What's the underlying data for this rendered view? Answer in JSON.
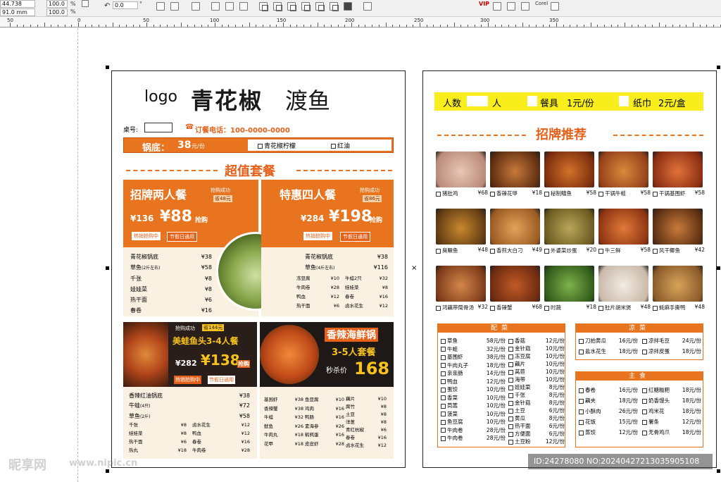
{
  "toolbar": {
    "size_w": "44.738 mm",
    "size_h": "91.0 mm",
    "scale_x": "100.0",
    "scale_y": "100.0",
    "pct": "%",
    "rotation": "0.0",
    "deg": "°",
    "vip_label": "VIP",
    "corel_label": "Corel"
  },
  "ruler": {
    "labels": [
      "50",
      "0",
      "50",
      "100",
      "150",
      "200",
      "250",
      "300",
      "350"
    ]
  },
  "left_page": {
    "logo": "logo",
    "brand": "青花椒",
    "brand2": "渡鱼",
    "table_no_label": "桌号:",
    "phone": "订餐电话：100-0000-0000",
    "pot_label": "锅底：",
    "pot_price": "38",
    "pot_unit": "元/份",
    "pot_opt1": "青花椒柠檬",
    "pot_opt2": "红油",
    "section_title": "超值套餐",
    "set1": {
      "title": "招牌两人餐",
      "tag1": "抢购成功",
      "tag2": "省48元",
      "old": "¥136",
      "price": "¥88",
      "buy": "抢购",
      "hot": "热销抢购中",
      "hol": "节假日通用",
      "items": [
        [
          "青花椒锅底",
          "¥38"
        ],
        [
          "草鱼",
          "(2斤左右)",
          "¥58"
        ],
        [
          "千张",
          "¥8"
        ],
        [
          "娃娃菜",
          "¥8"
        ],
        [
          "热干面",
          "¥6"
        ],
        [
          "春卷",
          "¥16"
        ]
      ]
    },
    "set2": {
      "title": "特惠四人餐",
      "tag1": "抢购成功",
      "tag2": "省86元",
      "old": "¥284",
      "price": "¥198",
      "buy": "抢购",
      "hot": "热销抢购中",
      "hol": "节假日通用",
      "items": [
        [
          "青花椒锅底",
          "¥38"
        ],
        [
          "草鱼",
          "(4斤左右)",
          "¥116"
        ]
      ],
      "small": [
        [
          "冻豆腐",
          "¥10"
        ],
        [
          "牛蛙2只",
          "¥32"
        ],
        [
          "牛肉卷",
          "¥28"
        ],
        [
          "娃娃菜",
          "¥8"
        ],
        [
          "鸭血",
          "¥12"
        ],
        [
          "春卷",
          "¥16"
        ],
        [
          "热干面",
          "¥6"
        ],
        [
          "卤水花生",
          "¥12"
        ]
      ]
    },
    "set3": {
      "tag1": "抢购成功",
      "tag2": "省144元",
      "title": "美蛙鱼头3-4人餐",
      "old": "¥282",
      "price": "¥138",
      "buy": "抢购",
      "hot": "热销抢购中",
      "hol": "节假日通用",
      "items": [
        [
          "香辣红油锅底",
          "¥38"
        ],
        [
          "牛蛙",
          "(4只)",
          "¥72"
        ],
        [
          "草鱼",
          "(2斤)",
          "¥58"
        ]
      ],
      "small": [
        [
          "千张",
          "¥8"
        ],
        [
          "卤水花生",
          "¥12"
        ],
        [
          "娃娃菜",
          "¥8"
        ],
        [
          "鸭血",
          "¥12"
        ],
        [
          "热干面",
          "¥6"
        ],
        [
          "春卷",
          "¥16"
        ],
        [
          "热丸",
          "¥18"
        ],
        [
          "牛肉卷",
          "¥28"
        ]
      ]
    },
    "set4": {
      "title": "香辣海鲜锅",
      "sub": "3-5人套餐",
      "promo": "秒杀价",
      "price": "168",
      "col1": [
        [
          "基围虾",
          "¥38"
        ],
        [
          "香辣蟹",
          "¥38"
        ],
        [
          "牛蛙",
          "¥32"
        ],
        [
          "鱿鱼",
          "¥26"
        ],
        [
          "牛肉丸",
          "¥18"
        ],
        [
          "花甲",
          "¥18"
        ]
      ],
      "col2": [
        [
          "鱼豆腐",
          "¥10"
        ],
        [
          "鸡肉",
          "¥16"
        ],
        [
          "鸭肠",
          "¥16"
        ],
        [
          "素海参",
          "¥26"
        ],
        [
          "鹌鹑蛋",
          "¥16"
        ],
        [
          "皮皮虾",
          "¥28"
        ]
      ],
      "col3": [
        [
          "藕片",
          "¥10"
        ],
        [
          "腐竹",
          "¥8"
        ],
        [
          "土豆",
          "¥8"
        ],
        [
          "洋葱",
          "¥8"
        ],
        [
          "青红杭椒",
          "¥6"
        ],
        [
          "春卷",
          "¥16"
        ],
        [
          "卤水花生",
          "¥12"
        ]
      ]
    }
  },
  "right_page": {
    "people": "人数",
    "people_unit": "人",
    "tableware": "餐具",
    "tableware_price": "1元/份",
    "tissue": "纸巾",
    "tissue_price": "2元/盒",
    "signature_title": "招牌推荐",
    "dishes": [
      [
        "猪肚鸡",
        "¥68"
      ],
      [
        "香辣花甲",
        "¥18"
      ],
      [
        "秘制鳝鱼",
        "¥58"
      ],
      [
        "干锅牛蛙",
        "¥58"
      ],
      [
        "干锅基围虾",
        "¥58"
      ],
      [
        "臭鳜鱼",
        "¥48"
      ],
      [
        "香煎大白刁",
        "¥49"
      ],
      [
        "外婆菜炒蛋",
        "¥20"
      ],
      [
        "牛三鲜",
        "¥58"
      ],
      [
        "风干鲫鱼",
        "¥42"
      ],
      [
        "鸿藕带筒骨汤",
        "¥32"
      ],
      [
        "香辣蟹",
        "¥68"
      ],
      [
        "时蔬",
        "¥18"
      ],
      [
        "肚片胡米煲",
        "¥48"
      ],
      [
        "蚝麻手撕鸭",
        "¥48"
      ]
    ],
    "sides_title": "配菜",
    "sides_col1": [
      [
        "草鱼",
        "58元/份"
      ],
      [
        "牛蛙",
        "32元/份"
      ],
      [
        "基围虾",
        "38元/份"
      ],
      [
        "牛肉丸子",
        "18元/份"
      ],
      [
        "亲亲肠",
        "14元/份"
      ],
      [
        "鸭血",
        "12元/份"
      ],
      [
        "蛋饺",
        "10元/份"
      ],
      [
        "香菜",
        "10元/份"
      ],
      [
        "茼蒿",
        "10元/份"
      ],
      [
        "菠菜",
        "10元/份"
      ],
      [
        "鱼豆腐",
        "10元/份"
      ],
      [
        "牛肉卷",
        "28元/份"
      ],
      [
        "牛肉卷",
        "28元/份"
      ]
    ],
    "sides_col2": [
      [
        "香菇",
        "12元/份"
      ],
      [
        "金针菇",
        "10元/份"
      ],
      [
        "冻豆腐",
        "10元/份"
      ],
      [
        "藕片",
        "10元/份"
      ],
      [
        "莴苣",
        "10元/份"
      ],
      [
        "海带",
        "10元/份"
      ],
      [
        "娃娃菜",
        "8元/份"
      ],
      [
        "千张",
        "8元/份"
      ],
      [
        "金针菇",
        "8元/份"
      ],
      [
        "土豆",
        "6元/份"
      ],
      [
        "黄瓜",
        "8元/份"
      ],
      [
        "热干面",
        "6元/份"
      ],
      [
        "方便面",
        "6元/份"
      ],
      [
        "土豆粉",
        "12元/份"
      ]
    ],
    "cold_title": "凉菜",
    "cold": [
      [
        "刀拍黄瓜",
        "16元/份"
      ],
      [
        "凉拌毛豆",
        "24元/份"
      ],
      [
        "盐水花生",
        "18元/份"
      ],
      [
        "凉拌皮蛋",
        "18元/份"
      ]
    ],
    "staple_title": "主食",
    "staple": [
      [
        "春卷",
        "16元/份"
      ],
      [
        "红糖糍粑",
        "18元/份"
      ],
      [
        "藕夹",
        "18元/份"
      ],
      [
        "奶香馒头",
        "18元/份"
      ],
      [
        "小酥肉",
        "26元/份"
      ],
      [
        "鸡米花",
        "18元/份"
      ],
      [
        "花饭",
        "15元/份"
      ],
      [
        "薯条",
        "12元/份"
      ],
      [
        "蒸饺",
        "12元/份"
      ],
      [
        "无骨鸡爪",
        "18元/份"
      ]
    ]
  },
  "watermark": {
    "logo": "昵享网",
    "url": "www.nipic.cn",
    "id": "ID:24278080 NO:20240427213035905108"
  }
}
